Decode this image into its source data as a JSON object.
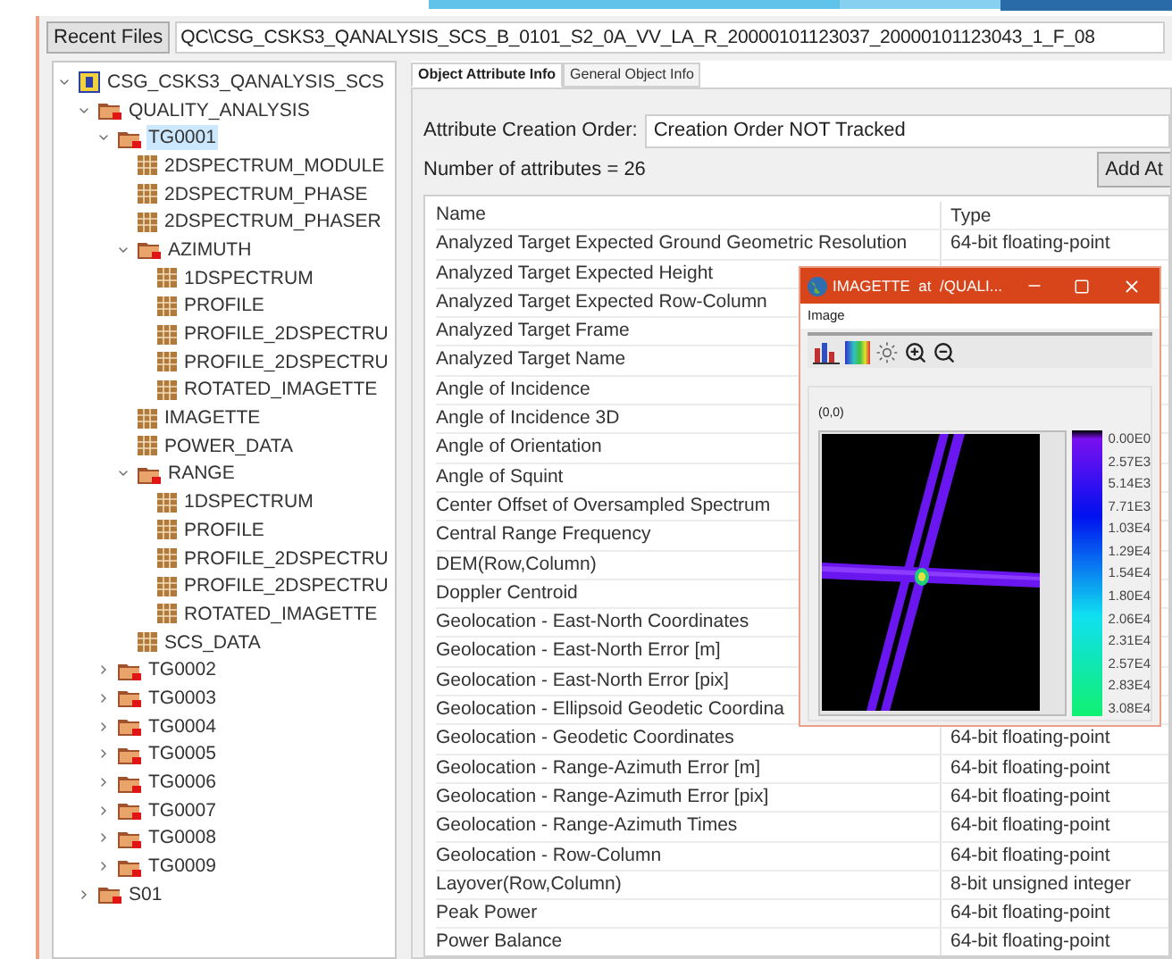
{
  "toolbar": {
    "recent_button": "Recent Files",
    "path": "QC\\CSG_CSKS3_QANALYSIS_SCS_B_0101_S2_0A_VV_LA_R_20000101123037_20000101123043_1_F_08"
  },
  "tree": [
    {
      "label": "CSG_CSKS3_QANALYSIS_SCS",
      "kind": "file",
      "expanded": true,
      "selected": false,
      "children": [
        {
          "label": "QUALITY_ANALYSIS",
          "kind": "group",
          "expanded": true,
          "selected": false,
          "children": [
            {
              "label": "TG0001",
              "kind": "group",
              "expanded": true,
              "selected": true,
              "children": [
                {
                  "label": "2DSPECTRUM_MODULE",
                  "kind": "dataset",
                  "selected": false
                },
                {
                  "label": "2DSPECTRUM_PHASE",
                  "kind": "dataset",
                  "selected": false
                },
                {
                  "label": "2DSPECTRUM_PHASER",
                  "kind": "dataset",
                  "selected": false
                },
                {
                  "label": "AZIMUTH",
                  "kind": "group",
                  "expanded": true,
                  "selected": false,
                  "children": [
                    {
                      "label": "1DSPECTRUM",
                      "kind": "dataset",
                      "selected": false
                    },
                    {
                      "label": "PROFILE",
                      "kind": "dataset",
                      "selected": false
                    },
                    {
                      "label": "PROFILE_2DSPECTRU",
                      "kind": "dataset",
                      "selected": false
                    },
                    {
                      "label": "PROFILE_2DSPECTRU",
                      "kind": "dataset",
                      "selected": false
                    },
                    {
                      "label": "ROTATED_IMAGETTE",
                      "kind": "dataset",
                      "selected": false
                    }
                  ]
                },
                {
                  "label": "IMAGETTE",
                  "kind": "dataset",
                  "selected": false
                },
                {
                  "label": "POWER_DATA",
                  "kind": "dataset",
                  "selected": false
                },
                {
                  "label": "RANGE",
                  "kind": "group",
                  "expanded": true,
                  "selected": false,
                  "children": [
                    {
                      "label": "1DSPECTRUM",
                      "kind": "dataset",
                      "selected": false
                    },
                    {
                      "label": "PROFILE",
                      "kind": "dataset",
                      "selected": false
                    },
                    {
                      "label": "PROFILE_2DSPECTRU",
                      "kind": "dataset",
                      "selected": false
                    },
                    {
                      "label": "PROFILE_2DSPECTRU",
                      "kind": "dataset",
                      "selected": false
                    },
                    {
                      "label": "ROTATED_IMAGETTE",
                      "kind": "dataset",
                      "selected": false
                    }
                  ]
                },
                {
                  "label": "SCS_DATA",
                  "kind": "dataset",
                  "selected": false
                }
              ]
            },
            {
              "label": "TG0002",
              "kind": "group",
              "expanded": false,
              "selected": false
            },
            {
              "label": "TG0003",
              "kind": "group",
              "expanded": false,
              "selected": false
            },
            {
              "label": "TG0004",
              "kind": "group",
              "expanded": false,
              "selected": false
            },
            {
              "label": "TG0005",
              "kind": "group",
              "expanded": false,
              "selected": false
            },
            {
              "label": "TG0006",
              "kind": "group",
              "expanded": false,
              "selected": false
            },
            {
              "label": "TG0007",
              "kind": "group",
              "expanded": false,
              "selected": false
            },
            {
              "label": "TG0008",
              "kind": "group",
              "expanded": false,
              "selected": false
            },
            {
              "label": "TG0009",
              "kind": "group",
              "expanded": false,
              "selected": false
            }
          ]
        },
        {
          "label": "S01",
          "kind": "group",
          "expanded": false,
          "selected": false
        }
      ]
    }
  ],
  "tabs": [
    {
      "label": "Object Attribute Info",
      "selected": true
    },
    {
      "label": "General Object Info",
      "selected": false
    }
  ],
  "creation_order": {
    "label": "Attribute Creation Order:",
    "value": "Creation Order NOT Tracked"
  },
  "attribute_count": "Number of attributes = 26",
  "add_button": "Add At",
  "table": {
    "columns": [
      "Name",
      "Type"
    ],
    "rows": [
      {
        "name": "Analyzed Target Expected Ground Geometric Resolution",
        "type": "64-bit floating-point"
      },
      {
        "name": "Analyzed Target Expected Height"
      },
      {
        "name": "Analyzed Target Expected Row-Column"
      },
      {
        "name": "Analyzed Target Frame"
      },
      {
        "name": "Analyzed Target Name"
      },
      {
        "name": "Angle of Incidence"
      },
      {
        "name": "Angle of Incidence 3D"
      },
      {
        "name": "Angle of Orientation"
      },
      {
        "name": "Angle of Squint"
      },
      {
        "name": "Center Offset of Oversampled Spectrum"
      },
      {
        "name": "Central Range Frequency"
      },
      {
        "name": "DEM(Row,Column)"
      },
      {
        "name": "Doppler Centroid"
      },
      {
        "name": "Geolocation - East-North Coordinates"
      },
      {
        "name": "Geolocation - East-North Error [m]"
      },
      {
        "name": "Geolocation - East-North Error [pix]"
      },
      {
        "name": "Geolocation - Ellipsoid Geodetic Coordina"
      },
      {
        "name": "Geolocation - Geodetic Coordinates",
        "type": "64-bit floating-point"
      },
      {
        "name": "Geolocation - Range-Azimuth Error [m]",
        "type": "64-bit floating-point"
      },
      {
        "name": "Geolocation - Range-Azimuth Error [pix]",
        "type": "64-bit floating-point"
      },
      {
        "name": "Geolocation - Range-Azimuth Times",
        "type": "64-bit floating-point"
      },
      {
        "name": "Geolocation - Row-Column",
        "type": "64-bit floating-point"
      },
      {
        "name": "Layover(Row,Column)",
        "type": "8-bit unsigned integer"
      },
      {
        "name": "Peak Power",
        "type": "64-bit floating-point"
      },
      {
        "name": "Power Balance",
        "type": "64-bit floating-point"
      }
    ]
  },
  "image_window": {
    "title": "IMAGETTE  at  /QUALI...",
    "menu": [
      "Image"
    ],
    "coordinates": "(0,0)",
    "colorbar_labels": [
      "0.00E0",
      "2.57E3",
      "5.14E3",
      "7.71E3",
      "1.03E4",
      "1.29E4",
      "1.54E4",
      "1.80E4",
      "2.06E4",
      "2.31E4",
      "2.57E4",
      "2.83E4",
      "3.08E4"
    ]
  }
}
